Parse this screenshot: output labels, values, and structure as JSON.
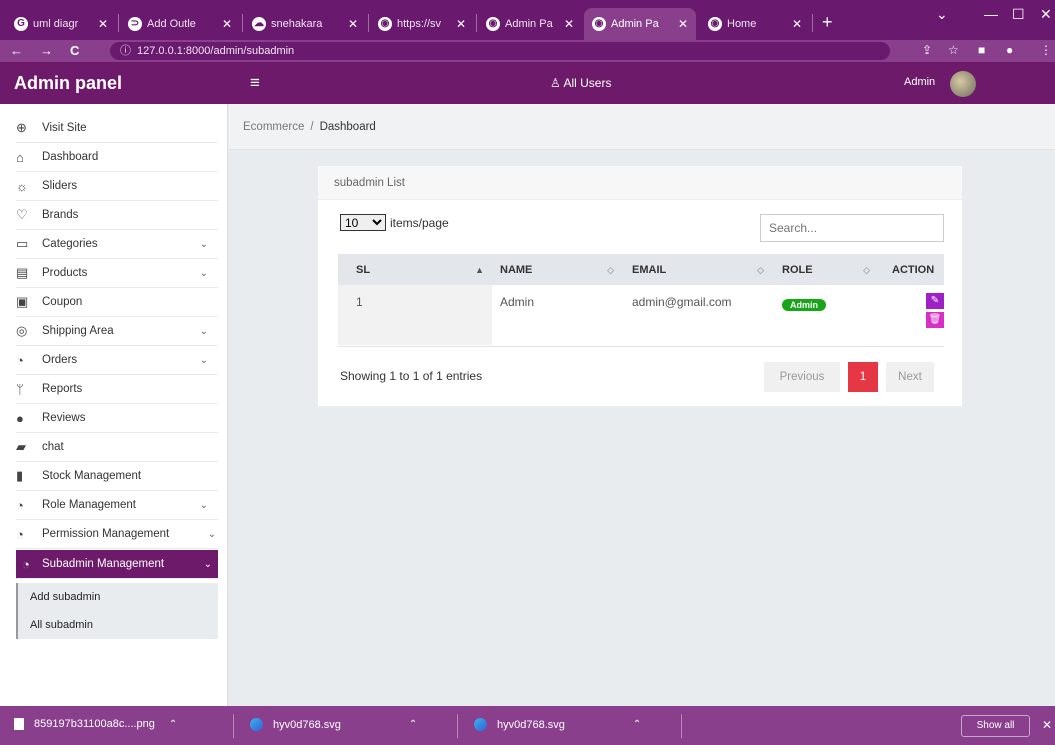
{
  "browser": {
    "tabs": [
      {
        "label": "uml diagr"
      },
      {
        "label": "Add Outle"
      },
      {
        "label": "snehakara"
      },
      {
        "label": "https://sv"
      },
      {
        "label": "Admin Pa"
      },
      {
        "label": "Admin Pa"
      },
      {
        "label": "Home"
      }
    ],
    "url": "127.0.0.1:8000/admin/subadmin"
  },
  "header": {
    "brand": "Admin panel",
    "center_link": "All Users",
    "user_name": "Admin"
  },
  "sidebar": {
    "items": [
      {
        "label": "Visit Site",
        "icon": "globe-icon"
      },
      {
        "label": "Dashboard",
        "icon": "home-icon"
      },
      {
        "label": "Sliders",
        "icon": "sun-icon"
      },
      {
        "label": "Brands",
        "icon": "heart-icon"
      },
      {
        "label": "Categories",
        "icon": "folder-icon"
      },
      {
        "label": "Products",
        "icon": "box-icon"
      },
      {
        "label": "Coupon",
        "icon": "calendar-icon"
      },
      {
        "label": "Shipping Area",
        "icon": "location-icon"
      },
      {
        "label": "Orders",
        "icon": "pie-icon"
      },
      {
        "label": "Reports",
        "icon": "branch-icon"
      },
      {
        "label": "Reviews",
        "icon": "info-icon"
      },
      {
        "label": "chat",
        "icon": "chat-icon"
      },
      {
        "label": "Stock Management",
        "icon": "bookmark-icon"
      },
      {
        "label": "Role Management",
        "icon": "pie-icon"
      },
      {
        "label": "Permission Management",
        "icon": "pie-icon"
      },
      {
        "label": "Subadmin Management",
        "icon": "pie-icon"
      }
    ],
    "submenu": [
      {
        "label": "Add subadmin"
      },
      {
        "label": "All subadmin"
      }
    ]
  },
  "breadcrumb": {
    "parent": "Ecommerce",
    "separator": "/",
    "current": "Dashboard"
  },
  "card": {
    "title": "subadmin List",
    "per_page_value": "10",
    "per_page_label": "items/page",
    "search_placeholder": "Search...",
    "columns": [
      "SL",
      "NAME",
      "EMAIL",
      "ROLE",
      "ACTION"
    ],
    "rows": [
      {
        "sl": "1",
        "name": "Admin",
        "email": "admin@gmail.com",
        "role": "Admin"
      }
    ],
    "showing": "Showing 1 to 1 of 1 entries",
    "pagination": {
      "previous": "Previous",
      "page": "1",
      "next": "Next"
    }
  },
  "downloads": {
    "items": [
      {
        "name": "859197b31100a8c....png"
      },
      {
        "name": "hyv0d768.svg"
      },
      {
        "name": "hyv0d768.svg"
      }
    ],
    "show_all": "Show all"
  },
  "colors": {
    "brand": "#6d1a6b",
    "role_badge": "#18a518",
    "edit": "#a020c8",
    "delete": "#d92fc6",
    "page_active": "#e53744"
  }
}
